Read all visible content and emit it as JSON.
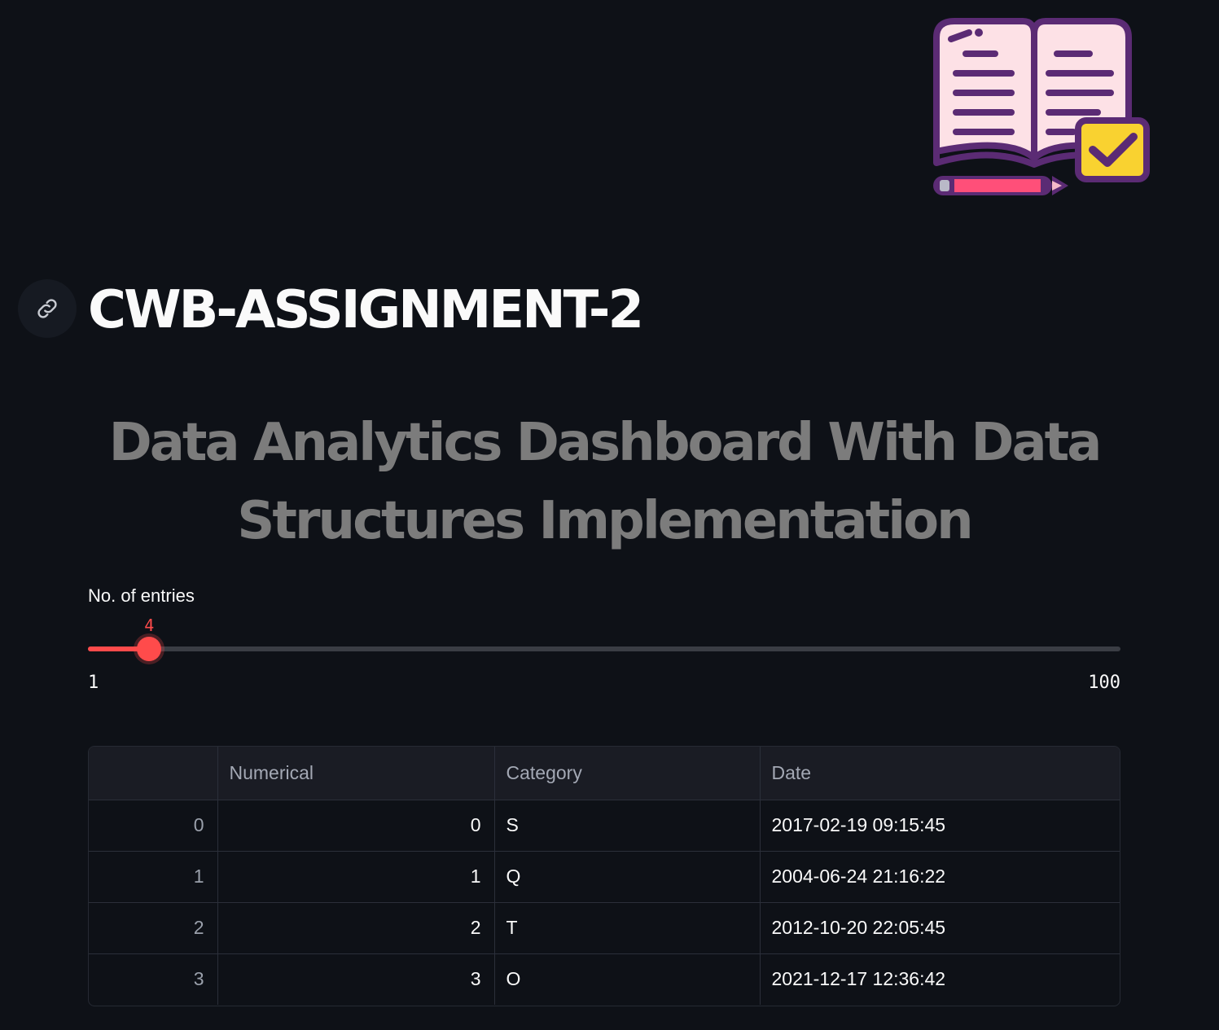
{
  "header": {
    "title": "CWB-ASSIGNMENT-2",
    "subtitle": "Data Analytics Dashboard With Data Structures Implementation"
  },
  "slider": {
    "label": "No. of entries",
    "value": 4,
    "min": 1,
    "max": 100,
    "min_label": "1",
    "max_label": "100",
    "value_label": "4",
    "accent_color": "#ff4b4b"
  },
  "table": {
    "columns": [
      "",
      "Numerical",
      "Category",
      "Date"
    ],
    "rows": [
      {
        "index": "0",
        "numerical": "0",
        "category": "S",
        "date": "2017-02-19 09:15:45"
      },
      {
        "index": "1",
        "numerical": "1",
        "category": "Q",
        "date": "2004-06-24 21:16:22"
      },
      {
        "index": "2",
        "numerical": "2",
        "category": "T",
        "date": "2012-10-20 22:05:45"
      },
      {
        "index": "3",
        "numerical": "3",
        "category": "O",
        "date": "2021-12-17 12:36:42"
      }
    ]
  },
  "colors": {
    "background": "#0e1117",
    "subtitle": "#7c7c7c",
    "accent": "#ff4b4b"
  },
  "icons": {
    "logo": "open-book-with-checkmark-icon",
    "anchor": "link-icon"
  }
}
